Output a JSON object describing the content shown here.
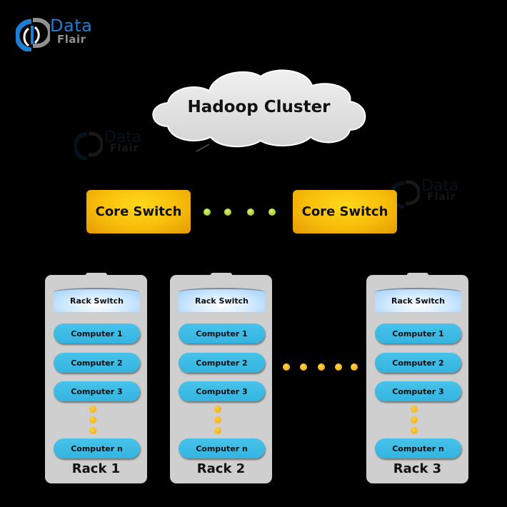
{
  "logo": {
    "text_top": "Data",
    "text_bottom": "Flair",
    "colors": {
      "primary": "#1d7fd3",
      "secondary": "#8f8f8f"
    }
  },
  "watermark": {
    "text_top": "Data",
    "text_bottom": "Flair"
  },
  "cluster": {
    "title": "Hadoop Cluster"
  },
  "core_switches": [
    {
      "label": "Core Switch"
    },
    {
      "label": "Core Switch"
    }
  ],
  "core_connector_dots": 4,
  "rack_connector_dots": 5,
  "racks": [
    {
      "name": "Rack 1",
      "switch": "Rack Switch",
      "computers": [
        "Computer 1",
        "Computer 2",
        "Computer 3",
        "Computer n"
      ]
    },
    {
      "name": "Rack 2",
      "switch": "Rack Switch",
      "computers": [
        "Computer 1",
        "Computer 2",
        "Computer 3",
        "Computer n"
      ]
    },
    {
      "name": "Rack 3",
      "switch": "Rack Switch",
      "computers": [
        "Computer 1",
        "Computer 2",
        "Computer 3",
        "Computer n"
      ]
    }
  ],
  "colors": {
    "background": "#000000",
    "core_switch": "#f7bd0a",
    "computer": "#3bbbe5",
    "rack": "#cfcfcf",
    "green_dot": "#a6d236",
    "orange_dot": "#f5b10f"
  }
}
